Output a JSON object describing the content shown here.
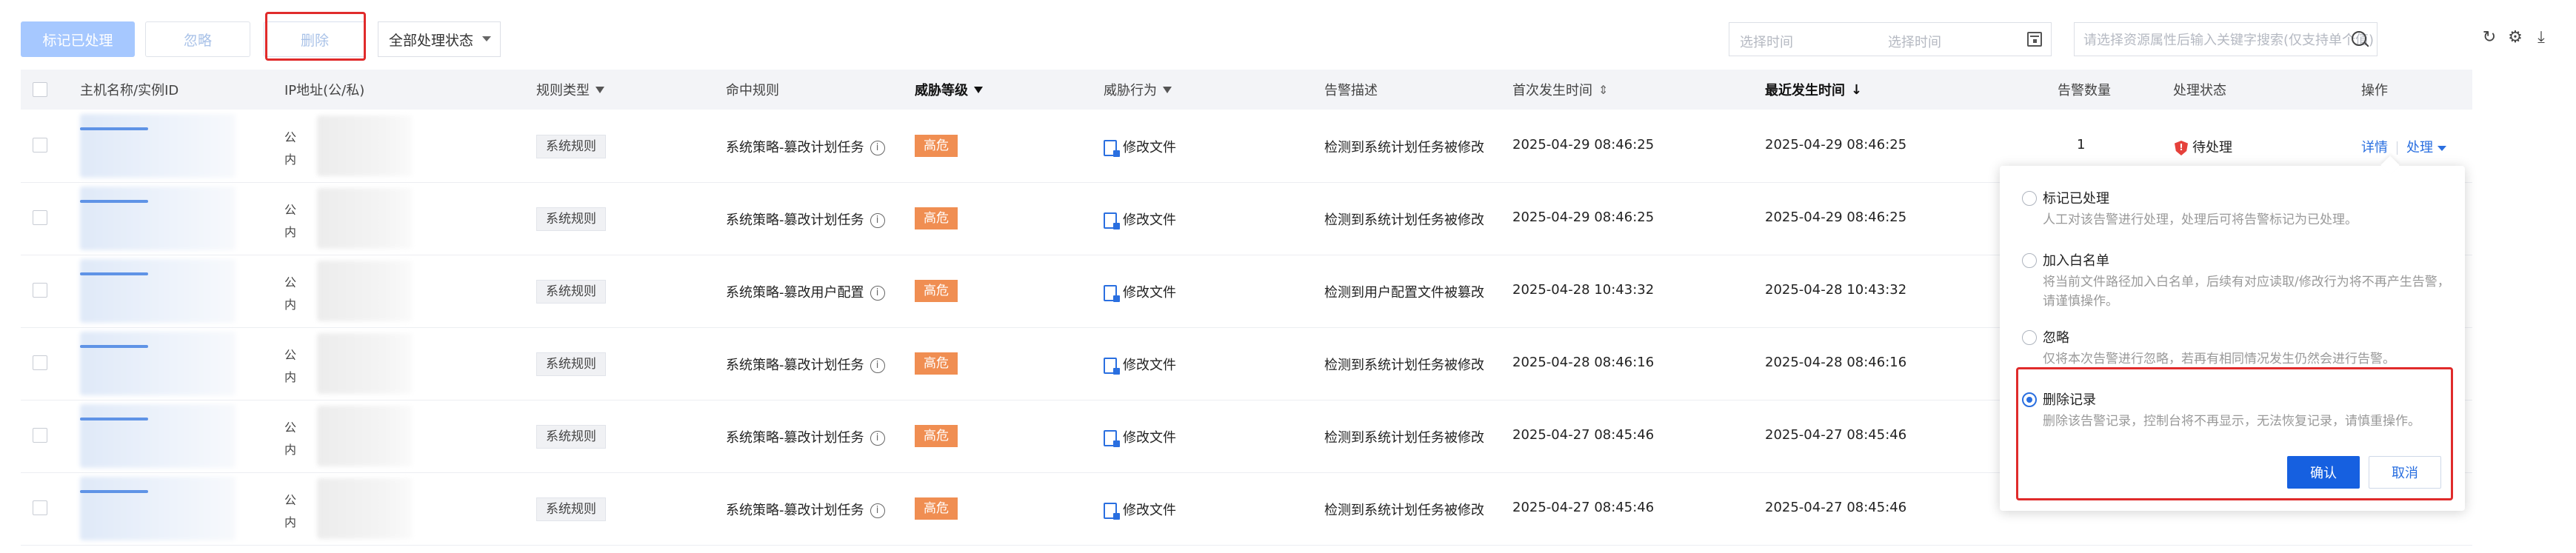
{
  "toolbar": {
    "mark_processed": "标记已处理",
    "ignore": "忽略",
    "delete": "删除",
    "status_select": "全部处理状态",
    "date_start_placeholder": "选择时间",
    "date_end_placeholder": "选择时间",
    "search_placeholder": "请选择资源属性后输入关键字搜索(仅支持单个值)"
  },
  "columns": {
    "host": "主机名称/实例ID",
    "ip": "IP地址(公/私)",
    "rule_type": "规则类型",
    "hit_rule": "命中规则",
    "threat_level": "威胁等级",
    "threat_action": "威胁行为",
    "alert_desc": "告警描述",
    "first_time": "首次发生时间",
    "last_time": "最近发生时间",
    "alert_count": "告警数量",
    "status": "处理状态",
    "actions": "操作"
  },
  "ip_prefix": {
    "public": "公",
    "private": "内"
  },
  "rows": [
    {
      "rule_type": "系统规则",
      "hit_rule": "系统策略-篡改计划任务",
      "level": "高危",
      "action": "修改文件",
      "desc": "检测到系统计划任务被修改",
      "first": "2025-04-29 08:46:25",
      "last": "2025-04-29 08:46:25",
      "count": "1",
      "status": "待处理",
      "detail": "详情",
      "handle": "处理"
    },
    {
      "rule_type": "系统规则",
      "hit_rule": "系统策略-篡改计划任务",
      "level": "高危",
      "action": "修改文件",
      "desc": "检测到系统计划任务被修改",
      "first": "2025-04-29 08:46:25",
      "last": "2025-04-29 08:46:25"
    },
    {
      "rule_type": "系统规则",
      "hit_rule": "系统策略-篡改用户配置",
      "level": "高危",
      "action": "修改文件",
      "desc": "检测到用户配置文件被篡改",
      "first": "2025-04-28 10:43:32",
      "last": "2025-04-28 10:43:32"
    },
    {
      "rule_type": "系统规则",
      "hit_rule": "系统策略-篡改计划任务",
      "level": "高危",
      "action": "修改文件",
      "desc": "检测到系统计划任务被修改",
      "first": "2025-04-28 08:46:16",
      "last": "2025-04-28 08:46:16"
    },
    {
      "rule_type": "系统规则",
      "hit_rule": "系统策略-篡改计划任务",
      "level": "高危",
      "action": "修改文件",
      "desc": "检测到系统计划任务被修改",
      "first": "2025-04-27 08:45:46",
      "last": "2025-04-27 08:45:46"
    },
    {
      "rule_type": "系统规则",
      "hit_rule": "系统策略-篡改计划任务",
      "level": "高危",
      "action": "修改文件",
      "desc": "检测到系统计划任务被修改",
      "first": "2025-04-27 08:45:46",
      "last": "2025-04-27 08:45:46"
    }
  ],
  "popover": {
    "options": [
      {
        "title": "标记已处理",
        "desc": "人工对该告警进行处理，处理后可将告警标记为已处理。"
      },
      {
        "title": "加入白名单",
        "desc": "将当前文件路径加入白名单，后续有对应读取/修改行为将不再产生告警，请谨慎操作。"
      },
      {
        "title": "忽略",
        "desc": "仅将本次告警进行忽略，若再有相同情况发生仍然会进行告警。"
      },
      {
        "title": "删除记录",
        "desc": "删除该告警记录，控制台将不再显示，无法恢复记录，请慎重操作。"
      }
    ],
    "selected_index": 3,
    "confirm": "确认",
    "cancel": "取消"
  },
  "colors": {
    "accent": "#1660e0",
    "high_risk": "#f08e52",
    "highlight_frame": "#e02b2b"
  },
  "icons": [
    "filter-icon",
    "sort-icon",
    "info-icon",
    "file-edit-icon",
    "shield-alert-icon",
    "calendar-icon",
    "search-icon",
    "refresh-icon",
    "settings-icon",
    "download-icon"
  ]
}
